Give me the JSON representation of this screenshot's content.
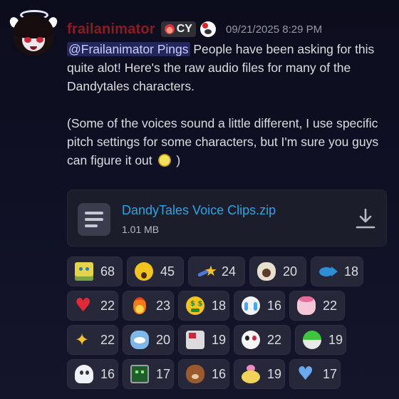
{
  "message": {
    "username": "frailanimator",
    "tag_label": "CY",
    "timestamp": "09/21/2025 8:29 PM",
    "mention": "@Frailanimator Pings",
    "line1_rest": " People have been asking for this quite alot! Here's the raw audio files for many of the Dandytales characters.",
    "para2": "(Some of the voices sound a little different, I use specific pitch settings for some characters, but I'm sure you guys can figure it out",
    "para2_end": " )"
  },
  "attachment": {
    "file_name": "DandyTales Voice Clips.zip",
    "file_size": "1.01 MB"
  },
  "colors": {
    "username": "#8e1b23",
    "mention_bg": "#3a3f8f",
    "link": "#2ea4e6",
    "timestamp": "#949ba4"
  },
  "reactions": [
    {
      "emoji": "sponge-face-emoji",
      "count": "68"
    },
    {
      "emoji": "surprised-yellow-emoji",
      "count": "45"
    },
    {
      "emoji": "shooting-star-emoji",
      "count": "24"
    },
    {
      "emoji": "sheep-face-emoji",
      "count": "20"
    },
    {
      "emoji": "blue-fish-emoji",
      "count": "18"
    },
    {
      "emoji": "red-heart-emoji",
      "count": "22"
    },
    {
      "emoji": "fire-emoji",
      "count": "23"
    },
    {
      "emoji": "money-mouth-emoji",
      "count": "18"
    },
    {
      "emoji": "crying-face-emoji",
      "count": "16"
    },
    {
      "emoji": "pink-character-emoji",
      "count": "22"
    },
    {
      "emoji": "sparkles-emoji",
      "count": "22"
    },
    {
      "emoji": "blue-character-emoji",
      "count": "20"
    },
    {
      "emoji": "robot-character-emoji",
      "count": "19"
    },
    {
      "emoji": "panda-character-emoji",
      "count": "22"
    },
    {
      "emoji": "green-ball-emoji",
      "count": "19"
    },
    {
      "emoji": "ghost-character-emoji",
      "count": "16"
    },
    {
      "emoji": "green-monitor-emoji",
      "count": "17"
    },
    {
      "emoji": "brown-dog-emoji",
      "count": "16"
    },
    {
      "emoji": "flower-character-emoji",
      "count": "19"
    },
    {
      "emoji": "blue-heart-emoji",
      "count": "17"
    }
  ]
}
